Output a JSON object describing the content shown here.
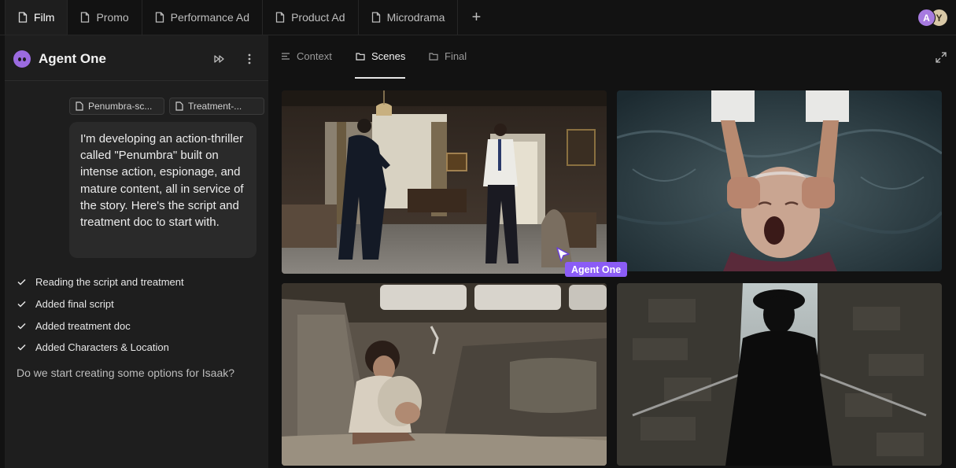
{
  "tabs": [
    {
      "label": "Film",
      "active": true
    },
    {
      "label": "Promo",
      "active": false
    },
    {
      "label": "Performance Ad",
      "active": false
    },
    {
      "label": "Product Ad",
      "active": false
    },
    {
      "label": "Microdrama",
      "active": false
    }
  ],
  "add_tab_label": "+",
  "collaborators": [
    "A",
    "Y"
  ],
  "agent": {
    "name": "Agent One",
    "attachments": [
      "Penumbra-sc...",
      "Treatment-..."
    ],
    "user_message": "I'm developing an action-thriller called \"Penumbra\" built on intense action, espionage, and mature content, all in service of the story. Here's the script and treatment doc to start with.",
    "steps": [
      "Reading the script and treatment",
      "Added final script",
      "Added treatment doc",
      "Added Characters & Location"
    ],
    "follow_up": "Do we start creating some options for Isaak?"
  },
  "canvas": {
    "subtabs": [
      {
        "label": "Context",
        "active": false
      },
      {
        "label": "Scenes",
        "active": true
      },
      {
        "label": "Final",
        "active": false
      }
    ],
    "cursor_label": "Agent One"
  },
  "colors": {
    "accent": "#8b5cf6",
    "agent_logo": "#9b6be0",
    "panel_bg": "#1e1e1e",
    "app_bg": "#121212"
  }
}
